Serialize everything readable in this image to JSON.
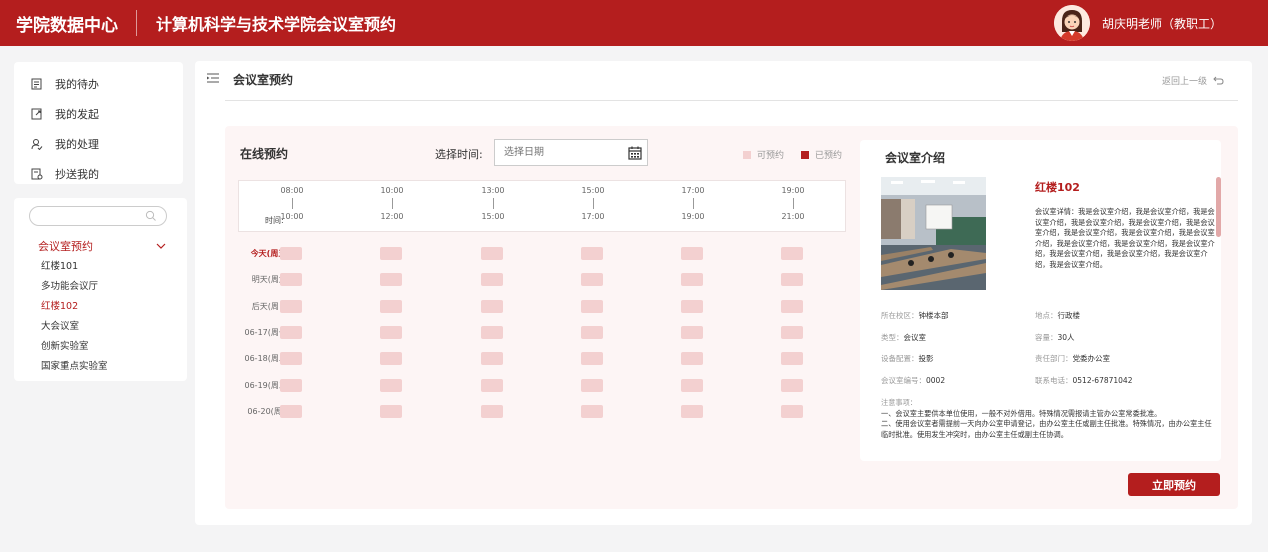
{
  "header": {
    "brand": "学院数据中心",
    "app_title": "计算机科学与技术学院会议室预约",
    "user_name": "胡庆明老师（教职工）"
  },
  "sidebar": {
    "menu": [
      {
        "label": "我的待办",
        "icon": "todo-icon"
      },
      {
        "label": "我的发起",
        "icon": "initiated-icon"
      },
      {
        "label": "我的处理",
        "icon": "handled-icon"
      },
      {
        "label": "抄送我的",
        "icon": "cc-icon"
      }
    ],
    "search": {
      "placeholder": "",
      "value": ""
    },
    "group_label": "会议室预约",
    "rooms": [
      {
        "label": "红楼101",
        "active": false
      },
      {
        "label": "多功能会议厅",
        "active": false
      },
      {
        "label": "红楼102",
        "active": true
      },
      {
        "label": "大会议室",
        "active": false
      },
      {
        "label": "创新实验室",
        "active": false
      },
      {
        "label": "国家重点实验室",
        "active": false
      }
    ]
  },
  "main": {
    "title": "会议室预约",
    "back_label": "返回上一级"
  },
  "booking": {
    "title": "在线预约",
    "select_time_label": "选择时间:",
    "date_placeholder": "选择日期",
    "legend": {
      "available": "可预约",
      "booked": "已预约"
    },
    "colors": {
      "available": "#f3d0d0",
      "booked": "#b41e1e",
      "accent": "#b41e1e"
    },
    "time_label": "时间:",
    "slots": [
      {
        "start": "08:00",
        "end": "10:00"
      },
      {
        "start": "10:00",
        "end": "12:00"
      },
      {
        "start": "13:00",
        "end": "15:00"
      },
      {
        "start": "15:00",
        "end": "17:00"
      },
      {
        "start": "17:00",
        "end": "19:00"
      },
      {
        "start": "19:00",
        "end": "21:00"
      }
    ],
    "days": [
      {
        "label": "今天(周五)",
        "today": true
      },
      {
        "label": "明天(周六)",
        "today": false
      },
      {
        "label": "后天(周日)",
        "today": false
      },
      {
        "label": "06-17(周一)",
        "today": false
      },
      {
        "label": "06-18(周二)",
        "today": false
      },
      {
        "label": "06-19(周三)",
        "today": false
      },
      {
        "label": "06-20(周4)",
        "today": false
      }
    ]
  },
  "intro": {
    "title": "会议室介绍",
    "room_name": "红楼102",
    "description": "会议室详情：我是会议室介绍，我是会议室介绍，我是会议室介绍，我是会议室介绍，我是会议室介绍，我是会议室介绍，我是会议室介绍，我是会议室介绍，我是会议室介绍，我是会议室介绍，我是会议室介绍，我是会议室介绍，我是会议室介绍，我是会议室介绍，我是会议室介绍，我是会议室介绍。",
    "fields": [
      {
        "key": "所在校区：",
        "value": "钟楼本部"
      },
      {
        "key": "地点：",
        "value": "行政楼"
      },
      {
        "key": "类型：",
        "value": "会议室"
      },
      {
        "key": "容量：",
        "value": "30人"
      },
      {
        "key": "设备配置：",
        "value": "投影"
      },
      {
        "key": "责任部门：",
        "value": "党委办公室"
      },
      {
        "key": "会议室编号：",
        "value": "0002"
      },
      {
        "key": "联系电话：",
        "value": "0512-67871042"
      }
    ],
    "notes_title": "注意事项：",
    "notes": [
      "一、会议室主要供本单位使用，一般不对外借用。特殊情况需报请主管办公室常委批准。",
      "二、使用会议室者需提前一天向办公室申请登记，由办公室主任或副主任批准。特殊情况，由办公室主任临时批准。使用发生冲突时，由办公室主任或副主任协调。"
    ]
  },
  "book_button": "立即预约"
}
